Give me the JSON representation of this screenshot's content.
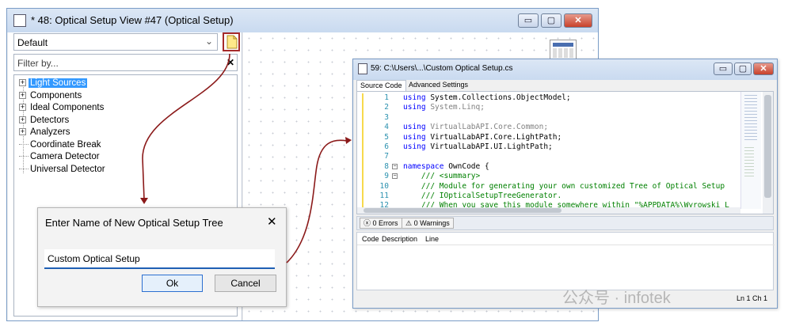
{
  "main_window": {
    "title": "* 48: Optical Setup View #47 (Optical Setup)",
    "btn_min": "▭",
    "btn_max": "▢",
    "btn_close": "✕"
  },
  "left_panel": {
    "dropdown_value": "Default",
    "filter_placeholder": "Filter by...",
    "filter_clear": "✕",
    "tree": [
      {
        "label": "Light Sources",
        "expand": "+"
      },
      {
        "label": "Components",
        "expand": "+"
      },
      {
        "label": "Ideal Components",
        "expand": "+"
      },
      {
        "label": "Detectors",
        "expand": "+"
      },
      {
        "label": "Analyzers",
        "expand": "+"
      },
      {
        "label": "Coordinate Break",
        "expand": ""
      },
      {
        "label": "Camera Detector",
        "expand": ""
      },
      {
        "label": "Universal Detector",
        "expand": ""
      }
    ]
  },
  "dialog": {
    "title": "Enter Name of New Optical Setup Tree",
    "close": "✕",
    "input_value": "Custom Optical Setup",
    "ok_label": "Ok",
    "cancel_label": "Cancel"
  },
  "code_window": {
    "title": "59: C:\\Users\\...\\Custom Optical Setup.cs",
    "btn_min": "▭",
    "btn_max": "▢",
    "btn_close": "✕",
    "tabs": [
      "Source Code",
      "Advanced Settings"
    ],
    "lines": [
      {
        "n": "1",
        "kw": "using",
        "rest": " System.Collections.ObjectModel;"
      },
      {
        "n": "2",
        "kw": "using",
        "rest": " System.Linq;"
      },
      {
        "n": "3",
        "kw": "",
        "rest": ""
      },
      {
        "n": "4",
        "kw": "using",
        "rest": " VirtualLabAPI.Core.Common;"
      },
      {
        "n": "5",
        "kw": "using",
        "rest": " VirtualLabAPI.Core.LightPath;"
      },
      {
        "n": "6",
        "kw": "using",
        "rest": " VirtualLabAPI.UI.LightPath;"
      },
      {
        "n": "7",
        "kw": "",
        "rest": ""
      },
      {
        "n": "8",
        "kw": "namespace",
        "rest": " OwnCode {"
      },
      {
        "n": "9",
        "kw": "",
        "rest": "    /// <summary>"
      },
      {
        "n": "10",
        "kw": "",
        "rest": "    /// Module for generating your own customized Tree of Optical Setup"
      },
      {
        "n": "11",
        "kw": "",
        "rest": "    /// IOpticalSetupTreeGenerator."
      },
      {
        "n": "12",
        "kw": "",
        "rest": "    /// When you save this module somewhere within \"%APPDATA%\\Wyrowski L"
      }
    ],
    "errors_label": "0 Errors",
    "warnings_label": "0 Warnings",
    "columns": [
      "Code",
      "Description",
      "Line"
    ],
    "status": "Ln 1  Ch 1"
  },
  "watermark": "公众号 · infotek",
  "colors": {
    "highlight": "#3399ff",
    "arrow": "#8b1a1a",
    "keyword": "#0000ff",
    "comment": "#008000",
    "linenum": "#2b91af"
  }
}
